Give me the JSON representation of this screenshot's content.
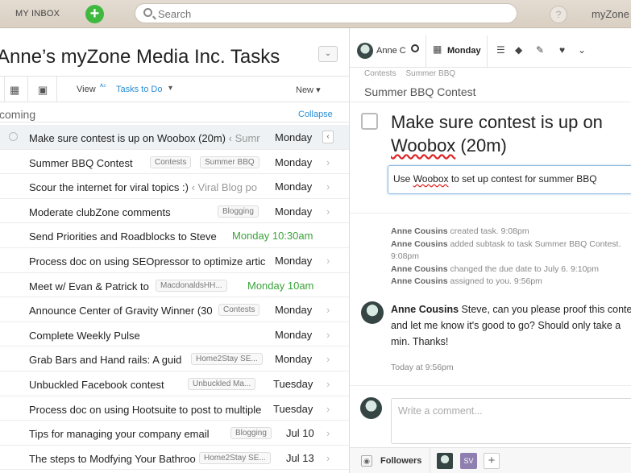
{
  "topbar": {
    "inbox_label": "MY INBOX",
    "add_icon": "plus-icon",
    "search_placeholder": "Search",
    "help_label": "?",
    "workspace_label": "myZone"
  },
  "project": {
    "title": "Anne’s myZone Media Inc. Tasks",
    "view_label": "View",
    "view_sort_glyph": "ᴬᶻ",
    "view_value": "Tasks to Do",
    "new_label": "New",
    "section_name": "coming",
    "collapse_label": "Collapse"
  },
  "tasks": [
    {
      "name_pre": "Make sure contest is up on ",
      "name_sq": "Woobox",
      "name_post": " (20m)",
      "sub": " ‹ Sumr",
      "tag": "",
      "due": "Monday",
      "due_green": false
    },
    {
      "name_pre": "Summer BBQ Contest",
      "name_sq": "",
      "name_post": "",
      "sub": "",
      "tag": "Contests",
      "tag2": "Summer BBQ",
      "due": "Monday",
      "due_green": false
    },
    {
      "name_pre": "Scour the internet for viral topics :)",
      "name_sq": "",
      "name_post": "",
      "sub": " ‹ Viral Blog po",
      "tag": "",
      "due": "Monday",
      "due_green": false
    },
    {
      "name_pre": "Moderate clubZone comments",
      "name_sq": "",
      "name_post": "",
      "sub": "",
      "tag": "Blogging",
      "due": "Monday",
      "due_green": false
    },
    {
      "name_pre": "Send Priorities and Roadblocks to Steve",
      "name_sq": "",
      "name_post": "",
      "sub": "",
      "tag": "",
      "due": "Monday 10:30am",
      "due_green": true
    },
    {
      "name_pre": "Process doc on using SEOpressor to optimize artic",
      "name_sq": "",
      "name_post": "",
      "sub": "",
      "tag": "",
      "due": "Monday",
      "due_green": false
    },
    {
      "name_pre": "Meet w/ Evan & Patrick to",
      "name_sq": "",
      "name_post": "",
      "sub": "",
      "tag": "MacdonaldsHH...",
      "due": "Monday 10am",
      "due_green": true
    },
    {
      "name_pre": "Announce Center of Gravity Winner (30",
      "name_sq": "",
      "name_post": "",
      "sub": "",
      "tag": "Contests",
      "due": "Monday",
      "due_green": false
    },
    {
      "name_pre": "Complete Weekly Pulse",
      "name_sq": "",
      "name_post": "",
      "sub": "",
      "tag": "",
      "due": "Monday",
      "due_green": false
    },
    {
      "name_pre": "Grab Bars and Hand rails: A guid",
      "name_sq": "",
      "name_post": "",
      "sub": "",
      "tag": "Home2Stay SE...",
      "due": "Monday",
      "due_green": false
    },
    {
      "name_pre": "Unbuckled Facebook contest",
      "name_sq": "",
      "name_post": "",
      "sub": "",
      "tag": "Unbuckled Ma...",
      "due": "Tuesday",
      "due_green": false
    },
    {
      "name_pre": "Process doc on using Hootsuite to post to multiple",
      "name_sq": "",
      "name_post": "",
      "sub": "",
      "tag": "",
      "due": "Tuesday",
      "due_green": false
    },
    {
      "name_pre": "Tips for managing your company email",
      "name_sq": "",
      "name_post": "",
      "sub": "",
      "tag": "Blogging",
      "due": "Jul 10",
      "due_green": false
    },
    {
      "name_pre": "The steps to Modfying Your Bathroo",
      "name_sq": "",
      "name_post": "",
      "sub": "",
      "tag": "Home2Stay SE...",
      "due": "Jul 13",
      "due_green": false
    }
  ],
  "detail": {
    "assignee": "Anne C",
    "due": "Monday",
    "crumb_1": "Contests",
    "crumb_2": "Summer BBQ",
    "project": "Summer BBQ Contest",
    "title_pre": "Make sure contest is up on",
    "title_sq": "Woobox",
    "title_post": " (20m)",
    "desc_pre": "Use ",
    "desc_sq": "Woobox",
    "desc_post": " to set up contest for summer BBQ",
    "activity": [
      {
        "who": "Anne Cousins",
        "what": " created task.  9:08pm"
      },
      {
        "who": "Anne Cousins",
        "what": " added subtask to task Summer BBQ Contest.  9:08pm"
      },
      {
        "who": "Anne Cousins",
        "what": " changed the due date to July 6.  9:10pm"
      },
      {
        "who": "Anne Cousins",
        "what": " assigned to you.  9:56pm"
      }
    ],
    "comment_author": "Anne Cousins",
    "comment_text": " Steve, can you please proof this contest and let me know it's good to go? Should only take a min. Thanks!",
    "comment_time": "Today at 9:56pm",
    "compose_placeholder": "Write a comment...",
    "followers_label": "Followers",
    "follower_initials": "SV"
  },
  "colors": {
    "accent_blue": "#2a8dd4",
    "due_green": "#3aa33a",
    "add_green": "#3fb83f"
  }
}
